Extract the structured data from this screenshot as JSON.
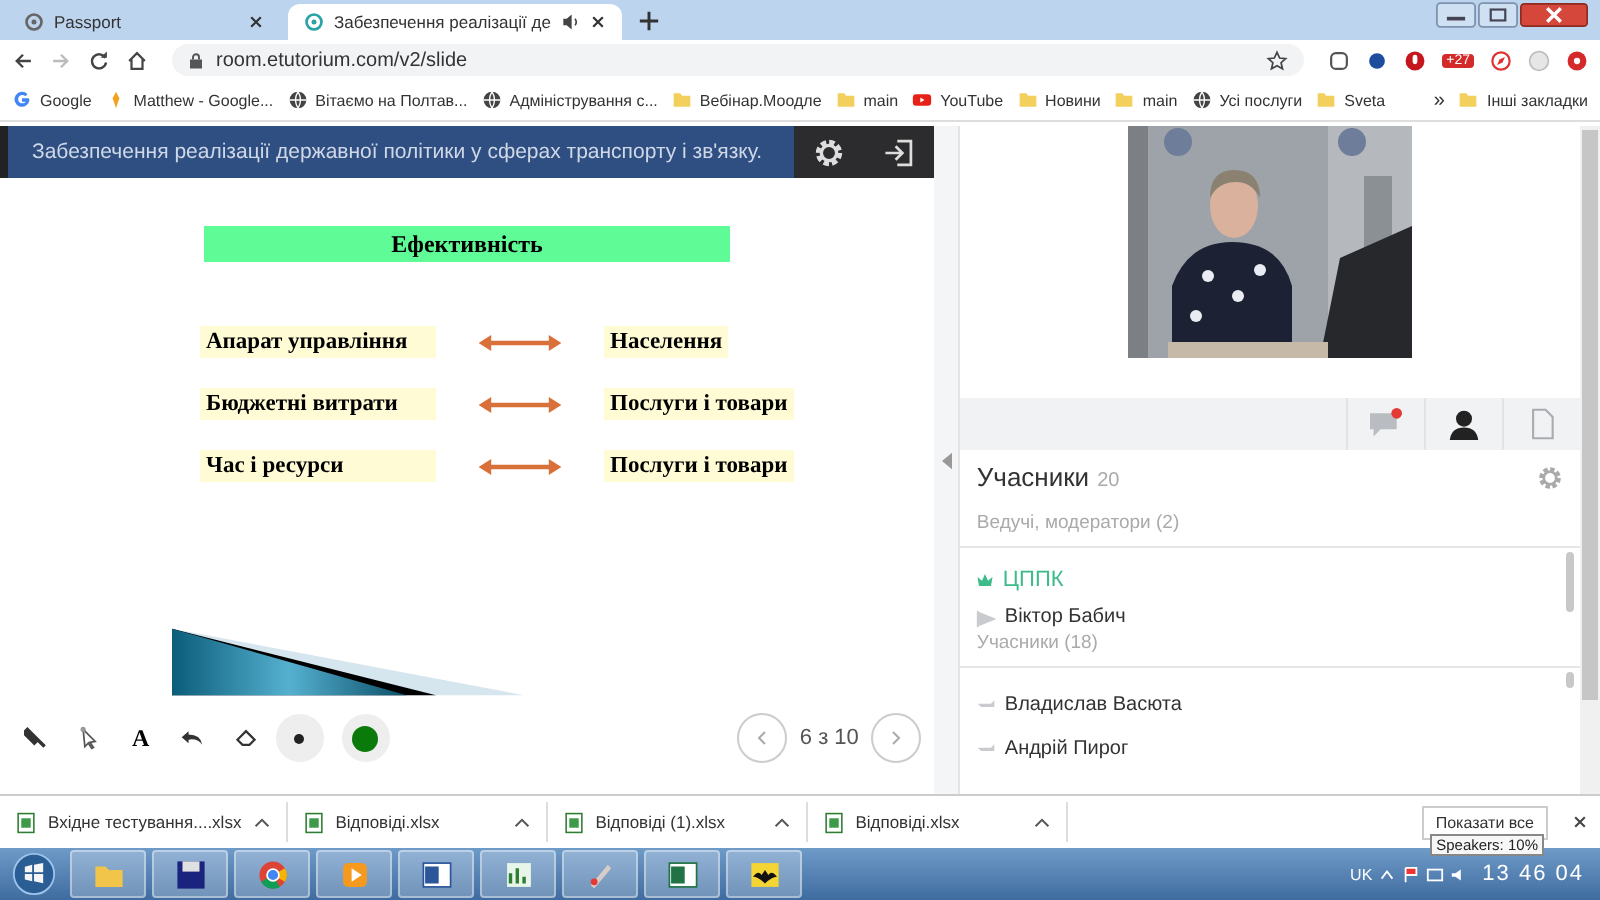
{
  "browser": {
    "tabs": [
      {
        "title": "Passport",
        "selected": false,
        "audio": false
      },
      {
        "title": "Забезпечення реалізації де",
        "selected": true,
        "audio": true
      }
    ],
    "address": "room.etutorium.com/v2/slide",
    "extension_badge": "+27",
    "bookmarks": [
      {
        "label": "Google",
        "kind": "google"
      },
      {
        "label": "Matthew - Google...",
        "kind": "site"
      },
      {
        "label": "Вітаємо на Полтав...",
        "kind": "globe"
      },
      {
        "label": "Адміністрування с...",
        "kind": "globe"
      },
      {
        "label": "Вебінар.Моодле",
        "kind": "folder"
      },
      {
        "label": "main",
        "kind": "folder"
      },
      {
        "label": "YouTube",
        "kind": "youtube"
      },
      {
        "label": "Новини",
        "kind": "folder"
      },
      {
        "label": "main",
        "kind": "folder"
      },
      {
        "label": "Усі послуги",
        "kind": "globe"
      },
      {
        "label": "Sveta",
        "kind": "folder"
      }
    ],
    "more": "»",
    "other_bookmarks": "Інші закладки"
  },
  "header": {
    "title": "Забезпечення реалізації державної політики у сферах транспорту і зв'язку."
  },
  "slide": {
    "title": "Ефективність",
    "rows": [
      {
        "left": "Апарат управління",
        "right": "Населення"
      },
      {
        "left": "Бюджетні витрати",
        "right": "Послуги і товари"
      },
      {
        "left": "Час і ресурси",
        "right": "Послуги і товари"
      }
    ]
  },
  "toolbar": {
    "tools": [
      {
        "kind": "marker"
      },
      {
        "kind": "pointer"
      },
      {
        "kind": "text",
        "label": "A"
      },
      {
        "kind": "undo"
      },
      {
        "kind": "eraser"
      },
      {
        "kind": "size"
      },
      {
        "kind": "color",
        "color": "#0a7a0a"
      }
    ],
    "page": "6 з 10"
  },
  "sidebar": {
    "tabs": [
      {
        "kind": "chat",
        "unread": true,
        "selected": false
      },
      {
        "kind": "people",
        "selected": true
      },
      {
        "kind": "files",
        "selected": false
      }
    ],
    "heading": "Учасники",
    "count": "20",
    "hosts_label": "Ведучі, модератори (2)",
    "host_group": "ЦППК",
    "hosts": [
      "Віктор Бабич"
    ],
    "participants_label": "Учасники (18)",
    "participants": [
      "Владислав Васюта",
      "Андрій Пирог"
    ]
  },
  "downloads": {
    "files": [
      "Вхідне тестування....xlsx",
      "Відповіді.xlsx",
      "Відповіді (1).xlsx",
      "Відповіді.xlsx"
    ],
    "show_all": "Показати все"
  },
  "taskbar": {
    "apps": [
      {
        "kind": "folder"
      },
      {
        "kind": "disk"
      },
      {
        "kind": "chrome"
      },
      {
        "kind": "media"
      },
      {
        "kind": "word"
      },
      {
        "kind": "chart"
      },
      {
        "kind": "paint"
      },
      {
        "kind": "excel"
      },
      {
        "kind": "bat"
      }
    ],
    "lang": "UK",
    "time": "13 46 04",
    "tooltip": "Speakers: 10%"
  }
}
